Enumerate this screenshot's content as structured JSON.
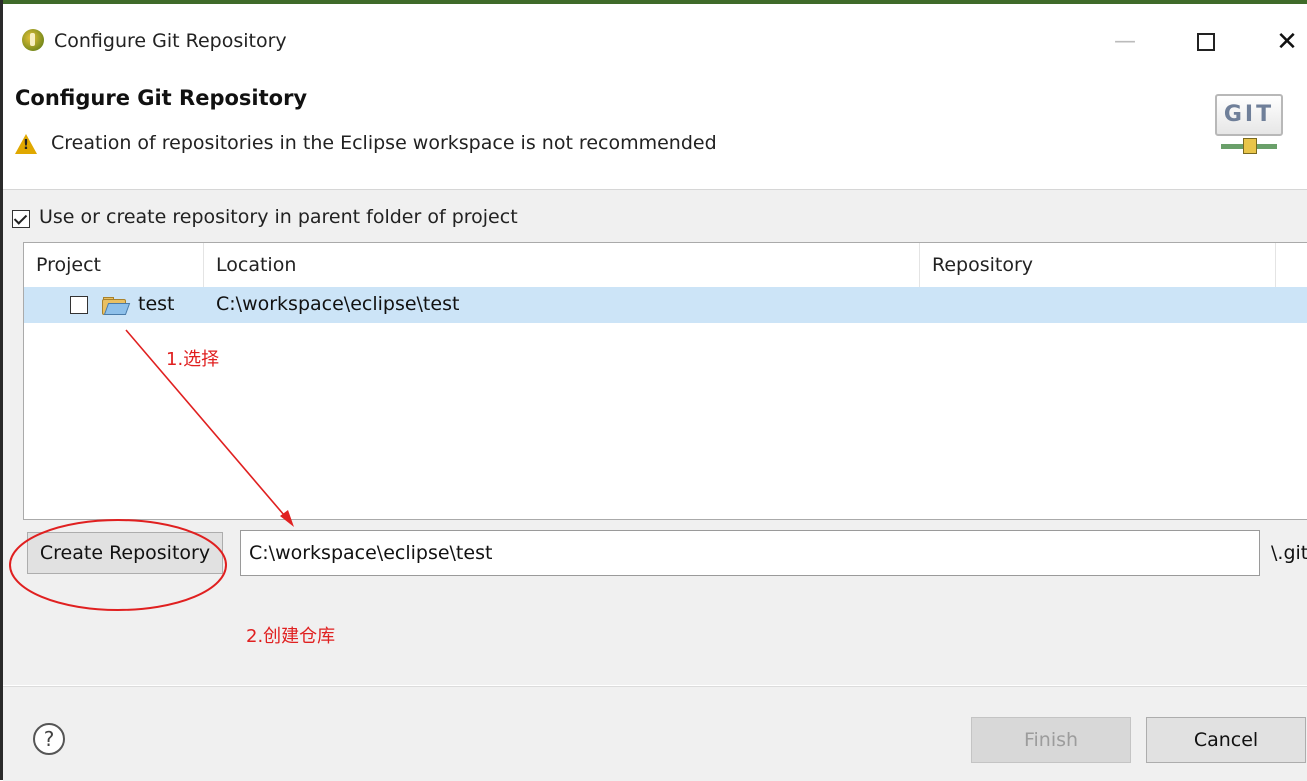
{
  "window": {
    "title": "Configure Git Repository",
    "controls": {
      "minimize": "—",
      "maximize": "",
      "close": "✕"
    }
  },
  "header": {
    "title": "Configure Git Repository",
    "warning": "Creation of repositories in the Eclipse workspace is not recommended",
    "logo_text": "GIT"
  },
  "options": {
    "use_parent_label": "Use or create repository in parent folder of project",
    "use_parent_checked": true
  },
  "table": {
    "columns": [
      "Project",
      "Location",
      "Repository"
    ],
    "rows": [
      {
        "project": "test",
        "location": "C:\\workspace\\eclipse\\test",
        "repository": "",
        "checked": false,
        "selected": true
      }
    ]
  },
  "create": {
    "button_label": "Create Repository",
    "path_value": "C:\\workspace\\eclipse\\test",
    "suffix": "\\.git"
  },
  "annotations": {
    "step1": "1.选择",
    "step2": "2.创建仓库",
    "color": "#e02020"
  },
  "footer": {
    "help": "?",
    "finish_label": "Finish",
    "cancel_label": "Cancel"
  },
  "colors": {
    "selection": "#cce4f7",
    "dialog_bg": "#f0f0f0",
    "accent_border": "#3f6b2a"
  }
}
